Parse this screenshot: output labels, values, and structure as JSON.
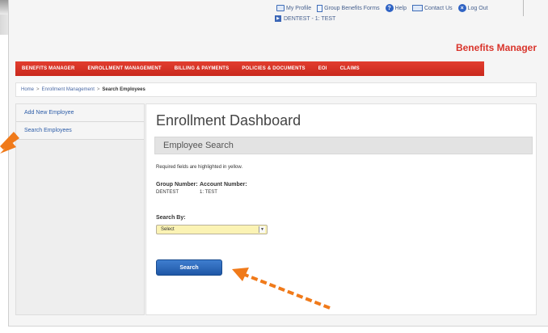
{
  "utility": {
    "my_profile": "My Profile",
    "group_forms": "Group Benefits Forms",
    "help": "Help",
    "contact": "Contact Us",
    "logout": "Log Out",
    "account": "DENTEST - 1: TEST"
  },
  "brand": "Benefits Manager",
  "nav": {
    "tabs": [
      "BENEFITS MANAGER",
      "ENROLLMENT MANAGEMENT",
      "BILLING & PAYMENTS",
      "POLICIES & DOCUMENTS",
      "EOI",
      "CLAIMS"
    ]
  },
  "breadcrumb": {
    "home": "Home",
    "enrollment": "Enrollment Management",
    "current": "Search Employees"
  },
  "sidebar": {
    "items": [
      {
        "label": "Add New Employee"
      },
      {
        "label": "Search Employees"
      }
    ]
  },
  "main": {
    "title": "Enrollment Dashboard",
    "section": "Employee Search",
    "required_note": "Required fields are highlighted in yellow.",
    "group_number_label": "Group Number:",
    "group_number_value": "DENTEST",
    "account_number_label": "Account Number:",
    "account_number_value": "1: TEST",
    "search_by_label": "Search By:",
    "search_by_value": "Select",
    "search_button": "Search"
  },
  "colors": {
    "nav_red": "#d1301f",
    "brand_red": "#d9342b",
    "button_blue": "#2a68bb",
    "required_yellow": "#fbf3b4",
    "annotation_orange": "#f07a1a"
  }
}
